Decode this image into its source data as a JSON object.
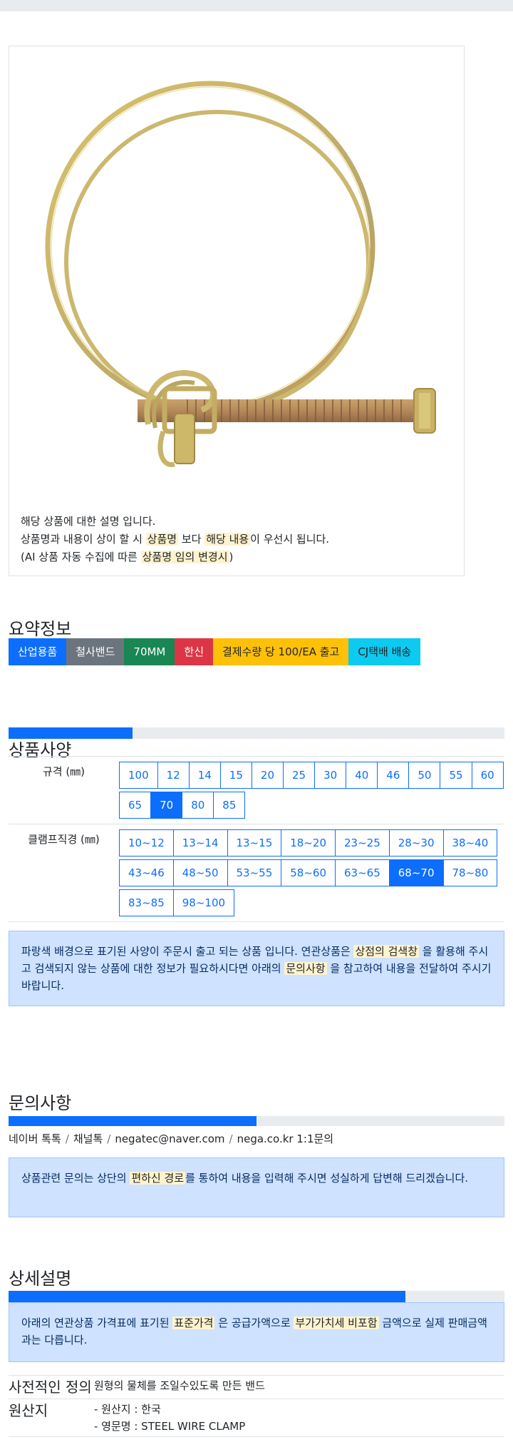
{
  "product": {
    "image_alt": "wire hose clamp",
    "desc_line1": "해당 상품에 대한 설명 입니다.",
    "desc_line2_a": "상품명과 내용이 상이 할 시 ",
    "desc_line2_mark1": "상품명",
    "desc_line2_b": " 보다 ",
    "desc_line2_mark2": "해당 내용",
    "desc_line2_c": "이 우선시 됩니다.",
    "desc_line3_a": "(AI 상품 자동 수집에 따른 ",
    "desc_line3_mark": "상품명 임의 변경시",
    "desc_line3_b": ")"
  },
  "summary": {
    "title": "요약정보",
    "badges": [
      {
        "label": "산업용품",
        "color": "#0d6efd",
        "text": "#ffffff"
      },
      {
        "label": "철사밴드",
        "color": "#6c757d",
        "text": "#ffffff"
      },
      {
        "label": "70MM",
        "color": "#198754",
        "text": "#ffffff"
      },
      {
        "label": "한신",
        "color": "#dc3545",
        "text": "#ffffff"
      },
      {
        "label": "결제수량 당 100/EA 출고",
        "color": "#ffc107",
        "text": "#212529"
      },
      {
        "label": "CJ택배 배송",
        "color": "#0dcaf0",
        "text": "#212529"
      }
    ]
  },
  "specs": {
    "title": "상품사양",
    "progress": 0.25,
    "rows": [
      {
        "label": "규격 (㎜)",
        "options": [
          "100",
          "12",
          "14",
          "15",
          "20",
          "25",
          "30",
          "40",
          "46",
          "50",
          "55",
          "60",
          "65",
          "70",
          "80",
          "85"
        ],
        "selected": "70"
      },
      {
        "label": "클램프직경 (㎜)",
        "options": [
          "10~12",
          "13~14",
          "13~15",
          "18~20",
          "23~25",
          "28~30",
          "38~40",
          "43~46",
          "48~50",
          "53~55",
          "58~60",
          "63~65",
          "68~70",
          "78~80",
          "83~85",
          "98~100"
        ],
        "selected": "68~70"
      }
    ],
    "notice_a": "파랑색 배경으로 표기된 사양이 주문시 출고 되는 상품 입니다. 연관상품은 ",
    "notice_mark1": "상점의 검색창",
    "notice_b": " 을 활용해 주시고 검색되지 않는 상품에 대한 정보가 필요하시다면 아래의 ",
    "notice_mark2": "문의사항",
    "notice_c": " 을 참고하여 내용을 전달하여 주시기 바랍니다."
  },
  "inquiry": {
    "title": "문의사항",
    "progress": 0.5,
    "channels": [
      "네이버 톡톡",
      "채널톡",
      "negatec@naver.com",
      "nega.co.kr 1:1문의"
    ],
    "notice_a": "상품관련 문의는 상단의 ",
    "notice_mark": "편하신 경로",
    "notice_b": "를 통하여 내용을 입력해 주시면 성실하게 답변해 드리겠습니다."
  },
  "detail": {
    "title": "상세설명",
    "progress": 0.8,
    "notice_a": "아래의 연관상품 가격표에 표기된 ",
    "notice_mark1": "표준가격",
    "notice_b": " 은 공급가액으로 ",
    "notice_mark2": "부가가치세 비포함",
    "notice_c": " 금액으로 실제 판매금액과는 다릅니다.",
    "rows": [
      {
        "key": "사전적인 정의",
        "values": [
          "원형의 물체를 조일수있도록 만든 밴드"
        ]
      },
      {
        "key": "원산지",
        "values": [
          "- 원산지 : 한국",
          "- 영문명 : STEEL WIRE CLAMP"
        ]
      }
    ]
  }
}
